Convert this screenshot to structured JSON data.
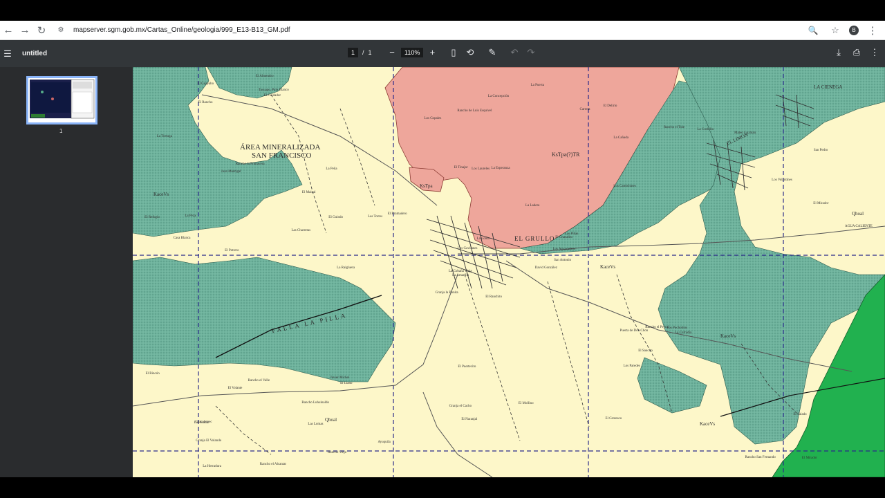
{
  "browser": {
    "url": "mapserver.sgm.gob.mx/Cartas_Online/geologia/999_E13-B13_GM.pdf",
    "avatar_letter": "B"
  },
  "pdf_toolbar": {
    "title": "untitled",
    "current_page": "1",
    "page_separator": "/",
    "total_pages": "1",
    "zoom": "110%"
  },
  "sidebar": {
    "thumbnail_label": "1"
  },
  "map": {
    "labels": {
      "area_line1": "ÁREA MINERALIZADA",
      "area_line2": "SAN FRANCISCO",
      "el_grullo": "EL GRULLO",
      "el_limon": "EL LIMON",
      "la_cienega": "LA CIENEGA",
      "ks_tpa": "KsTpa(?)TR",
      "ks_tpa2": "KsTpa",
      "kace_vs_1": "KaceVs",
      "kace_vs_2": "KaceVs",
      "kace_vs_3": "KaceVs",
      "kace_vs_4": "KaceVs",
      "qhoal_1": "Qhoal",
      "qhoal_2": "Qhoal",
      "falla": "FALLA LA PILLA",
      "agua_caliente": "AGUA CALIENTE"
    },
    "places": [
      "El Ranchito",
      "Juan Madrigal",
      "La Amarilla",
      "Chacaltepec",
      "El Chacalito",
      "El Llano",
      "El Delirio",
      "La Esperanza",
      "La Cañada",
      "David González",
      "El Cuidador",
      "El Mirador",
      "El Potrero",
      "San Pedro",
      "Granja la Bonita",
      "Los Camichines",
      "Rancho el Alcantar",
      "El Tinajar",
      "La Ladera",
      "Rancho el Valle",
      "El Bramadero",
      "Granja El Volando",
      "Las Lomas",
      "Los Laureles",
      "Las Piñas",
      "La Cofradía",
      "Rancho la Primavera",
      "Rancho de Luis Esquivel",
      "Casa Blanca",
      "Puerta de Don Chon",
      "El Mirador",
      "La Cobaña Vieja",
      "Granja el Cacho",
      "Los Gavilanes",
      "La Peña",
      "Rancho el Tule",
      "Javier Michel",
      "Rancho San Fernando",
      "El Salado",
      "Los Pochotitos",
      "La Puerta",
      "Las Torres",
      "Las Charretas",
      "Los Paredes",
      "Rancho Viejo",
      "El Refugio",
      "Los Aguacatitos",
      "La Herradura",
      "El Naranjal",
      "San Antonio",
      "El Volante",
      "Los Volantines",
      "La Tortuga",
      "El Saucito",
      "El Grotesco",
      "Rancho Luhuinaldo",
      "Tacuapo, Palo Blanco",
      "El Guayabo",
      "El Mollino",
      "Mateo Guzman",
      "La Concepción",
      "La Raigluera",
      "La Peza",
      "El Maizal",
      "La Cuchilla",
      "El Almendro",
      "Carrera",
      "Los Copales",
      "La Loma",
      "El Rincón",
      "El Puertecito",
      "Ayuquila",
      "Rancho el Peyral",
      "El Guindo",
      "Las Juntas",
      "El Rancho"
    ]
  }
}
